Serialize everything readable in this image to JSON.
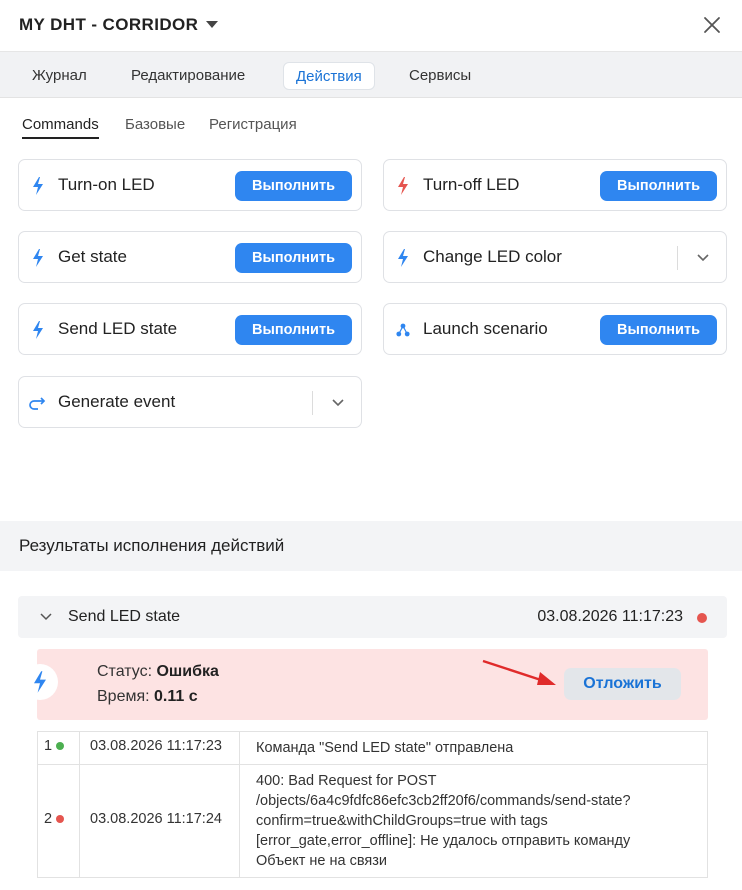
{
  "header": {
    "title": "MY DHT - CORRIDOR"
  },
  "tabs": [
    {
      "label": "Журнал"
    },
    {
      "label": "Редактирование"
    },
    {
      "label": "Действия"
    },
    {
      "label": "Сервисы"
    }
  ],
  "subtabs": [
    {
      "label": "Commands"
    },
    {
      "label": "Базовые"
    },
    {
      "label": "Регистрация"
    }
  ],
  "commands": [
    {
      "label": "Turn-on LED",
      "button": "Выполнить"
    },
    {
      "label": "Turn-off LED",
      "button": "Выполнить"
    },
    {
      "label": "Get state",
      "button": "Выполнить"
    },
    {
      "label": "Change LED color"
    },
    {
      "label": "Send LED state",
      "button": "Выполнить"
    },
    {
      "label": "Launch scenario",
      "button": "Выполнить"
    },
    {
      "label": "Generate event"
    }
  ],
  "results": {
    "title": "Результаты исполнения действий",
    "entry": {
      "name": "Send LED state",
      "datetime": "03.08.2026 11:17:23",
      "status_label": "Статус:",
      "status_value": "Ошибка",
      "time_label": "Время:",
      "time_value": "0.11 с",
      "postpone_button": "Отложить"
    },
    "log": [
      {
        "n": "1",
        "time": "03.08.2026 11:17:23",
        "lines": [
          "Команда \"Send LED state\" отправлена"
        ]
      },
      {
        "n": "2",
        "time": "03.08.2026 11:17:24",
        "lines": [
          "400: Bad Request for POST",
          "/objects/6a4c9fdfc86efc3cb2ff20f6/commands/send-state?",
          "confirm=true&withChildGroups=true with tags",
          "[error_gate,error_offline]: Не удалось отправить команду",
          "Объект не на связи"
        ]
      }
    ]
  },
  "colors": {
    "accent": "#2f86f0",
    "error": "#e5554f",
    "success": "#4caf50",
    "error_bg": "#fde3e3"
  }
}
